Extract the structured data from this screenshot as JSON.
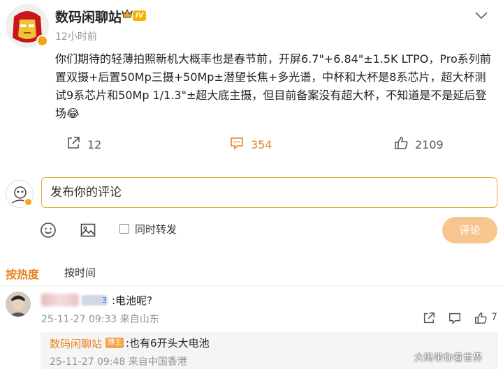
{
  "post": {
    "author": "数码闲聊站",
    "level": "IV",
    "time": "12小时前",
    "text": "你们期待的轻薄拍照新机大概率也是春节前，开屏6.7\"+6.84\"±1.5K LTPO，Pro系列前置双摄+后置50Mp三摄+50Mp±潜望长焦+多光谱，中杯和大杯是8系芯片，超大杯测试9系芯片和50Mp 1/1.3\"±超大底主摄，但目前备案没有超大杯，不知道是不是延后登场😂",
    "share_count": "12",
    "comment_count": "354",
    "like_count": "2109"
  },
  "composer": {
    "placeholder": "发布你的评论",
    "repost_label": "同时转发",
    "submit_label": "评论"
  },
  "sort": {
    "hot": "按热度",
    "time": "按时间"
  },
  "comment": {
    "user_level": "3",
    "text": ":电池呢?",
    "meta": "25-11-27 09:33 来自山东",
    "like_count": "7",
    "reply": {
      "author": "数码闲聊站",
      "badge": "博主",
      "text": ":也有6开头大电池",
      "meta": "25-11-27 09:48 来自中国香港"
    }
  },
  "watermark": "大码带你看世界",
  "colors": {
    "accent": "#e8801c",
    "input_border": "#f0a93f",
    "submit_bg": "#f7c58e",
    "vip": "#f7a21b"
  },
  "icons": [
    "crown-icon",
    "chevron-down-icon",
    "share-icon",
    "comment-icon",
    "like-icon",
    "emoji-icon",
    "image-icon",
    "reply-icon"
  ]
}
